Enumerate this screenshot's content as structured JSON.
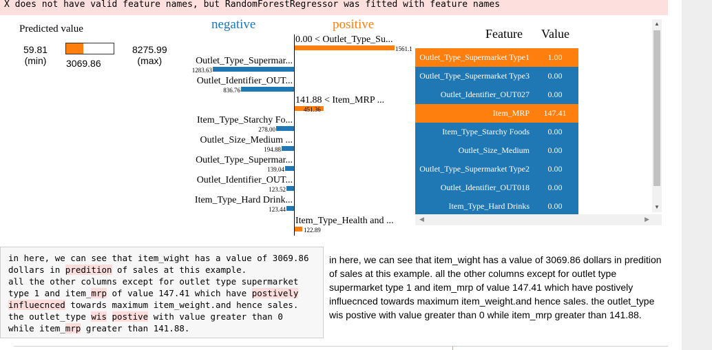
{
  "warning": {
    "text": "X does not have valid feature names, but RandomForestRegressor was fitted with feature names"
  },
  "predicted": {
    "title": "Predicted value",
    "min_value": "59.81",
    "min_label": "(min)",
    "max_value": "8275.99",
    "max_label": "(max)",
    "value": "3069.86",
    "fill_fraction": 0.366,
    "fill_color": "#ff7f0e"
  },
  "contributions": {
    "negative_label": "negative",
    "positive_label": "positive",
    "negative_color": "#1f77b4",
    "positive_color": "#ff7f0e",
    "negative": [
      {
        "label": "Outlet_Type_Supermar...",
        "value": "1283.63",
        "amount": 1283.63
      },
      {
        "label": "Outlet_Identifier_OUT...",
        "value": "836.76",
        "amount": 836.76
      },
      {
        "label": "Item_Type_Starchy Fo...",
        "value": "278.00",
        "amount": 278.0
      },
      {
        "label": "Outlet_Size_Medium ...",
        "value": "194.88",
        "amount": 194.88
      },
      {
        "label": "Outlet_Type_Supermar...",
        "value": "139.04",
        "amount": 139.04
      },
      {
        "label": "Outlet_Identifier_OUT...",
        "value": "123.52",
        "amount": 123.52
      },
      {
        "label": "Item_Type_Hard Drink...",
        "value": "123.44",
        "amount": 123.44
      }
    ],
    "positive": [
      {
        "label": "0.00 < Outlet_Type_Su...",
        "value": "1561.1",
        "amount": 1561.1
      },
      {
        "label": "141.88 < Item_MRP ...",
        "value": "451.36",
        "amount": 451.36
      },
      {
        "label": "Item_Type_Health and ...",
        "value": "122.89",
        "amount": 122.89
      }
    ]
  },
  "feature_table": {
    "header_feature": "Feature",
    "header_value": "Value",
    "rows": [
      {
        "feature": "Outlet_Type_Supermarket Type1",
        "value": "1.00",
        "color": "#ff7f0e"
      },
      {
        "feature": "Outlet_Type_Supermarket Type3",
        "value": "0.00",
        "color": "#1f77b4"
      },
      {
        "feature": "Outlet_Identifier_OUT027",
        "value": "0.00",
        "color": "#1f77b4"
      },
      {
        "feature": "Item_MRP",
        "value": "147.41",
        "color": "#ff7f0e"
      },
      {
        "feature": "Item_Type_Starchy Foods",
        "value": "0.00",
        "color": "#1f77b4"
      },
      {
        "feature": "Outlet_Size_Medium",
        "value": "0.00",
        "color": "#1f77b4"
      },
      {
        "feature": "Outlet_Type_Supermarket Type2",
        "value": "0.00",
        "color": "#1f77b4"
      },
      {
        "feature": "Outlet_Identifier_OUT018",
        "value": "0.00",
        "color": "#1f77b4"
      },
      {
        "feature": "Item_Type_Hard Drinks",
        "value": "0.00",
        "color": "#1f77b4"
      }
    ]
  },
  "markdown_source": {
    "segments": [
      {
        "t": "in here, we can see that item_wight has a value of 3069.86\ndollars in "
      },
      {
        "t": "predition",
        "hl": true
      },
      {
        "t": " of sales at this example.\nall the other columns except for outlet type supermarket\ntype 1 and item_"
      },
      {
        "t": "mrp",
        "hl": true
      },
      {
        "t": " of value 147.41 which have "
      },
      {
        "t": "postively",
        "hl": true
      },
      {
        "t": "\n"
      },
      {
        "t": "influecnced",
        "hl": true
      },
      {
        "t": " towards maximum item_weight.and hence sales.\nthe outlet_type "
      },
      {
        "t": "wis",
        "hl": true
      },
      {
        "t": " "
      },
      {
        "t": "postive",
        "hl": true
      },
      {
        "t": " with value greater than 0\nwhile item_"
      },
      {
        "t": "mrp",
        "hl": true
      },
      {
        "t": " greater than 141.88."
      }
    ]
  },
  "markdown_rendered": {
    "text": "in here, we can see that item_wight has a value of 3069.86 dollars in predition of sales at this example. all the other columns except for outlet type supermarket type 1 and item_mrp of value 147.41 which have postively influecnced towards maximum item_weight.and hence sales. the outlet_type wis postive with value greater than 0 while item_mrp greater than 141.88."
  }
}
